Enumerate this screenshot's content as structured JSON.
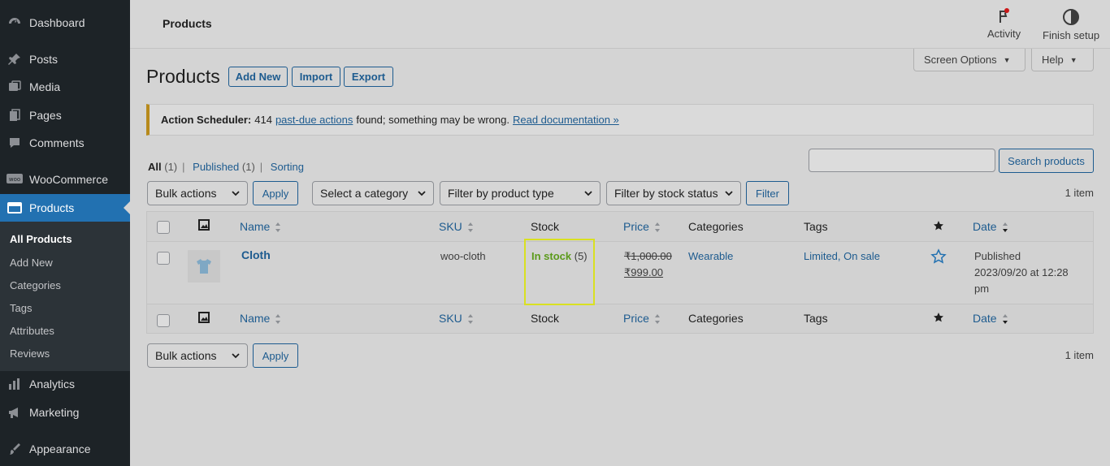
{
  "sidebar": {
    "items": [
      {
        "label": "Dashboard",
        "icon": "dashboard-icon"
      },
      {
        "label": "Posts",
        "icon": "pin-icon"
      },
      {
        "label": "Media",
        "icon": "media-icon"
      },
      {
        "label": "Pages",
        "icon": "pages-icon"
      },
      {
        "label": "Comments",
        "icon": "comment-icon"
      },
      {
        "label": "WooCommerce",
        "icon": "woo-icon"
      },
      {
        "label": "Products",
        "icon": "products-icon"
      },
      {
        "label": "Analytics",
        "icon": "analytics-icon"
      },
      {
        "label": "Marketing",
        "icon": "megaphone-icon"
      },
      {
        "label": "Appearance",
        "icon": "brush-icon"
      }
    ],
    "submenu": [
      "All Products",
      "Add New",
      "Categories",
      "Tags",
      "Attributes",
      "Reviews"
    ]
  },
  "topbar": {
    "title": "Products",
    "activity": "Activity",
    "finish_setup": "Finish setup"
  },
  "screen_options": "Screen Options",
  "help": "Help",
  "page": {
    "title": "Products",
    "add_new": "Add New",
    "import": "Import",
    "export": "Export"
  },
  "notice": {
    "label": "Action Scheduler:",
    "count": "414",
    "link1": "past-due actions",
    "text": "found; something may be wrong.",
    "link2": "Read documentation »"
  },
  "views": {
    "all": "All",
    "all_count": "(1)",
    "published": "Published",
    "published_count": "(1)",
    "sorting": "Sorting"
  },
  "search": {
    "placeholder": "",
    "button": "Search products"
  },
  "filters": {
    "bulk_actions": "Bulk actions",
    "apply": "Apply",
    "category": "Select a category",
    "product_type": "Filter by product type",
    "stock_status": "Filter by stock status",
    "filter": "Filter",
    "count": "1 item"
  },
  "table": {
    "headers": {
      "name": "Name",
      "sku": "SKU",
      "stock": "Stock",
      "price": "Price",
      "categories": "Categories",
      "tags": "Tags",
      "date": "Date"
    },
    "row": {
      "name": "Cloth",
      "sku": "woo-cloth",
      "stock_status": "In stock",
      "stock_qty": "(5)",
      "price_old": "₹1,000.00",
      "price_new": "₹999.00",
      "categories": "Wearable",
      "tags": "Limited, On sale",
      "date_status": "Published",
      "date_line1": "2023/09/20 at 12:28",
      "date_line2": "pm"
    }
  },
  "colors": {
    "accent": "#2271b1",
    "in_stock": "#5b9a1b",
    "highlight": "#d9e021"
  }
}
